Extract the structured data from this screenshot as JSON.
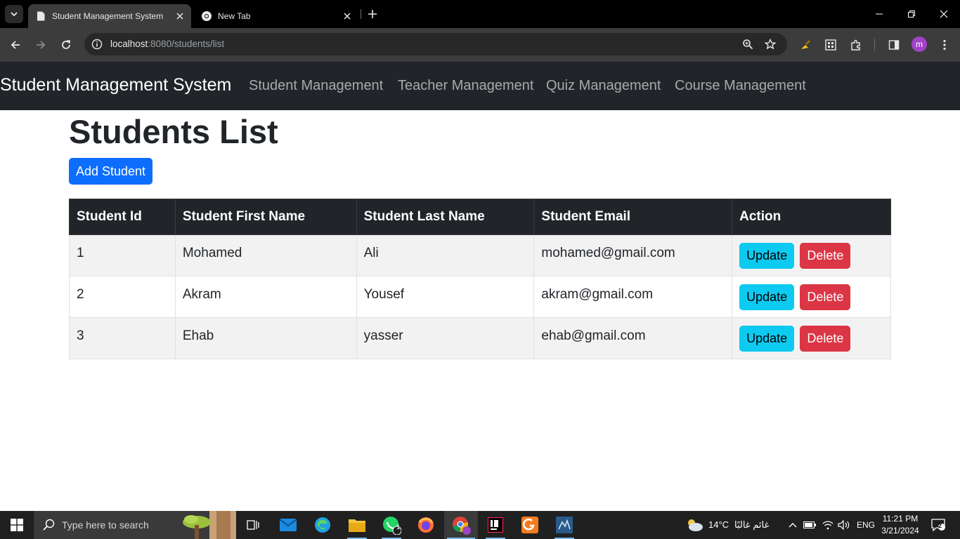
{
  "browser": {
    "tabs": [
      {
        "title": "Student Management System",
        "active": true
      },
      {
        "title": "New Tab",
        "active": false
      }
    ],
    "url": {
      "host": "localhost",
      "rest": ":8080/students/list"
    },
    "profile_initial": "m"
  },
  "navbar": {
    "brand": "Student Management System",
    "links": [
      "Student Management",
      "Teacher Management",
      "Quiz Management",
      "Course Management"
    ]
  },
  "main": {
    "title": "Students List",
    "add_button": "Add Student",
    "table": {
      "headers": [
        "Student Id",
        "Student First Name",
        "Student Last Name",
        "Student Email",
        "Action"
      ],
      "rows": [
        {
          "id": "1",
          "first": "Mohamed",
          "last": "Ali",
          "email": "mohamed@gmail.com"
        },
        {
          "id": "2",
          "first": "Akram",
          "last": "Yousef",
          "email": "akram@gmail.com"
        },
        {
          "id": "3",
          "first": "Ehab",
          "last": "yasser",
          "email": "ehab@gmail.com"
        }
      ],
      "update_label": "Update",
      "delete_label": "Delete"
    }
  },
  "taskbar": {
    "search_placeholder": "Type here to search",
    "whatsapp_badge": "1",
    "weather_temp": "14°C",
    "weather_desc": "غائم غالبًا",
    "language": "ENG",
    "time": "11:21 PM",
    "date": "3/21/2024",
    "notification_count": "2"
  },
  "colors": {
    "navbar_bg": "#212529",
    "primary": "#0d6efd",
    "info": "#0dcaf0",
    "danger": "#dc3545"
  }
}
